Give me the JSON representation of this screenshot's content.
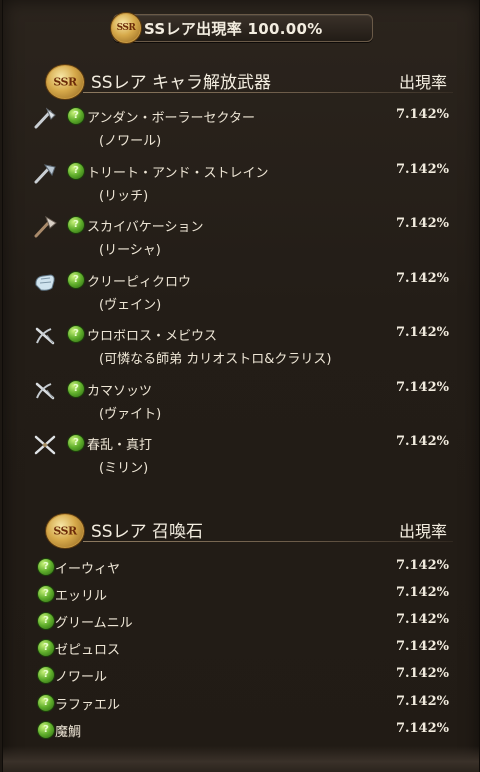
{
  "header": {
    "title": "SSレア出現率 100.00%",
    "badge": "SSR"
  },
  "weapons_section": {
    "badge": "SSR",
    "title": "SSレア キャラ解放武器",
    "rate_header": "出現率",
    "items": [
      {
        "name": "アンダン・ボーラーセクター",
        "character": "(ノワール)",
        "rate": "7.142%",
        "weapon_type": "axe-icon"
      },
      {
        "name": "トリート・アンド・ストレイン",
        "character": "(リッチ)",
        "rate": "7.142%",
        "weapon_type": "axe-icon"
      },
      {
        "name": "スカイバケーション",
        "character": "(リーシャ)",
        "rate": "7.142%",
        "weapon_type": "axe-icon"
      },
      {
        "name": "クリーピィクロウ",
        "character": "(ヴェイン)",
        "rate": "7.142%",
        "weapon_type": "gauntlet-icon"
      },
      {
        "name": "ウロボロス・メビウス",
        "character": "(可憐なる師弟 カリオストロ&クラリス)",
        "rate": "7.142%",
        "weapon_type": "crossbow-icon"
      },
      {
        "name": "カマソッツ",
        "character": "(ヴァイト)",
        "rate": "7.142%",
        "weapon_type": "crossbow-icon"
      },
      {
        "name": "春乱・真打",
        "character": "(ミリン)",
        "rate": "7.142%",
        "weapon_type": "katana-icon"
      }
    ]
  },
  "summons_section": {
    "badge": "SSR",
    "title": "SSレア 召喚石",
    "rate_header": "出現率",
    "items": [
      {
        "name": "イーウィヤ",
        "rate": "7.142%"
      },
      {
        "name": "エッリル",
        "rate": "7.142%"
      },
      {
        "name": "グリームニル",
        "rate": "7.142%"
      },
      {
        "name": "ゼピュロス",
        "rate": "7.142%"
      },
      {
        "name": "ノワール",
        "rate": "7.142%"
      },
      {
        "name": "ラファエル",
        "rate": "7.142%"
      },
      {
        "name": "魔鯛",
        "rate": "7.142%"
      }
    ]
  },
  "element_icon": "wind-element-icon",
  "colors": {
    "text": "#ece4d4",
    "panel": "#231d17",
    "gold": "#d6a94a",
    "wind": "#5fae2b"
  }
}
